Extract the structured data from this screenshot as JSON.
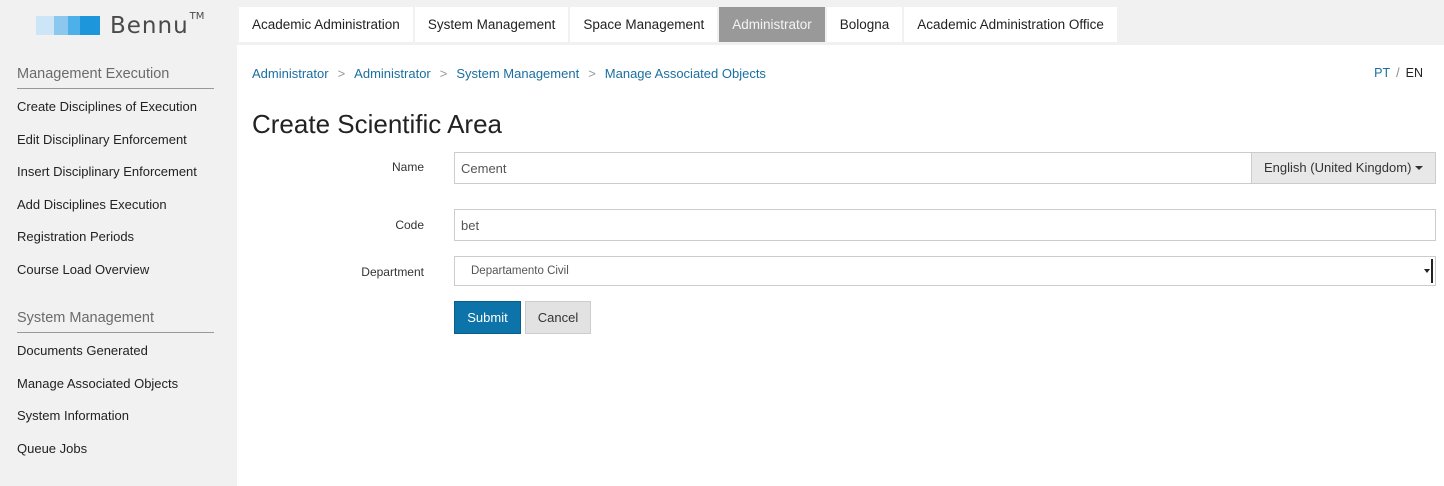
{
  "brand": {
    "name": "Bennu",
    "tm": "TM"
  },
  "topnav": {
    "tabs": [
      {
        "label": "Academic Administration",
        "active": false
      },
      {
        "label": "System Management",
        "active": false
      },
      {
        "label": "Space Management",
        "active": false
      },
      {
        "label": "Administrator",
        "active": true
      },
      {
        "label": "Bologna",
        "active": false
      },
      {
        "label": "Academic Administration Office",
        "active": false
      }
    ]
  },
  "sidebar": {
    "sections": [
      {
        "heading": "Management Execution",
        "items": [
          "Create Disciplines of Execution",
          "Edit Disciplinary Enforcement",
          "Insert Disciplinary Enforcement",
          "Add Disciplines Execution",
          "Registration Periods",
          "Course Load Overview"
        ]
      },
      {
        "heading": "System Management",
        "items": [
          "Documents Generated",
          "Manage Associated Objects",
          "System Information",
          "Queue Jobs"
        ]
      }
    ]
  },
  "breadcrumb": [
    "Administrator",
    "Administrator",
    "System Management",
    "Manage Associated Objects"
  ],
  "breadcrumb_sep": ">",
  "language_switch": {
    "pt": "PT",
    "sep": "/",
    "en": "EN"
  },
  "page_title": "Create Scientific Area",
  "form": {
    "name_label": "Name",
    "name_value": "Cement",
    "name_language": "English (United Kingdom)",
    "code_label": "Code",
    "code_value": "bet",
    "department_label": "Department",
    "department_value": "Departamento Civil",
    "submit_label": "Submit",
    "cancel_label": "Cancel"
  },
  "colors": {
    "accent": "#0c74a8",
    "link": "#1a6fa0",
    "active_tab": "#999999"
  }
}
